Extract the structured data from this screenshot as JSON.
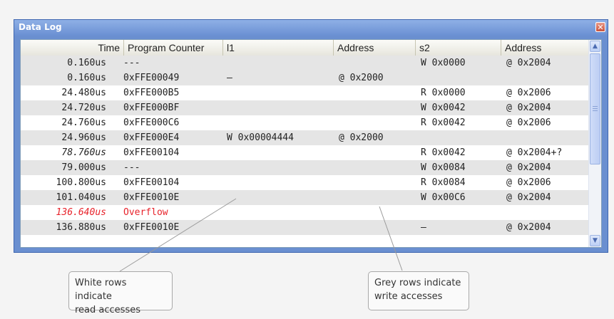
{
  "window": {
    "title": "Data Log",
    "close_glyph": "✕"
  },
  "columns": [
    "Time",
    "Program Counter",
    "l1",
    "Address",
    "s2",
    "Address"
  ],
  "rows": [
    {
      "shade": "grey",
      "time": "0.160us",
      "pc": "---",
      "l1": "",
      "addr1": "",
      "s2": "W 0x0000",
      "addr2": "@ 0x2004",
      "time_style": "normal"
    },
    {
      "shade": "grey",
      "time": "0.160us",
      "pc": "0xFFE00049",
      "l1": "–",
      "addr1": "@ 0x2000",
      "s2": "",
      "addr2": "",
      "time_style": "normal"
    },
    {
      "shade": "white",
      "time": "24.480us",
      "pc": "0xFFE000B5",
      "l1": "",
      "addr1": "",
      "s2": "R 0x0000",
      "addr2": "@ 0x2006",
      "time_style": "normal"
    },
    {
      "shade": "grey",
      "time": "24.720us",
      "pc": "0xFFE000BF",
      "l1": "",
      "addr1": "",
      "s2": "W 0x0042",
      "addr2": "@ 0x2004",
      "time_style": "normal"
    },
    {
      "shade": "white",
      "time": "24.760us",
      "pc": "0xFFE000C6",
      "l1": "",
      "addr1": "",
      "s2": "R 0x0042",
      "addr2": "@ 0x2006",
      "time_style": "normal"
    },
    {
      "shade": "grey",
      "time": "24.960us",
      "pc": "0xFFE000E4",
      "l1": "W 0x00004444",
      "addr1": "@ 0x2000",
      "s2": "",
      "addr2": "",
      "time_style": "normal"
    },
    {
      "shade": "white",
      "time": "78.760us",
      "pc": "0xFFE00104",
      "l1": "",
      "addr1": "",
      "s2": "R 0x0042",
      "addr2": "@ 0x2004+?",
      "time_style": "italic"
    },
    {
      "shade": "grey",
      "time": "79.000us",
      "pc": "---",
      "l1": "",
      "addr1": "",
      "s2": "W 0x0084",
      "addr2": "@ 0x2004",
      "time_style": "normal"
    },
    {
      "shade": "white",
      "time": "100.800us",
      "pc": "0xFFE00104",
      "l1": "",
      "addr1": "",
      "s2": "R 0x0084",
      "addr2": "@ 0x2006",
      "time_style": "normal"
    },
    {
      "shade": "grey",
      "time": "101.040us",
      "pc": "0xFFE0010E",
      "l1": "",
      "addr1": "",
      "s2": "W 0x00C6",
      "addr2": "@ 0x2004",
      "time_style": "normal"
    },
    {
      "shade": "white",
      "time": "136.640us",
      "pc": "Overflow",
      "l1": "",
      "addr1": "",
      "s2": "",
      "addr2": "",
      "time_style": "overflow"
    },
    {
      "shade": "grey",
      "time": "136.880us",
      "pc": "0xFFE0010E",
      "l1": "",
      "addr1": "",
      "s2": "–",
      "addr2": "@ 0x2004",
      "time_style": "normal"
    }
  ],
  "callouts": {
    "white_rows": "White rows indicate\nread accesses",
    "grey_rows": "Grey rows indicate\nwrite accesses"
  },
  "colors": {
    "overflow": "#e8232b",
    "grey_row": "#e5e5e5",
    "title_bar": "#6a8fd0"
  },
  "icons": {
    "scroll_up": "up-arrow-icon",
    "scroll_down": "down-arrow-icon",
    "close": "close-icon"
  }
}
